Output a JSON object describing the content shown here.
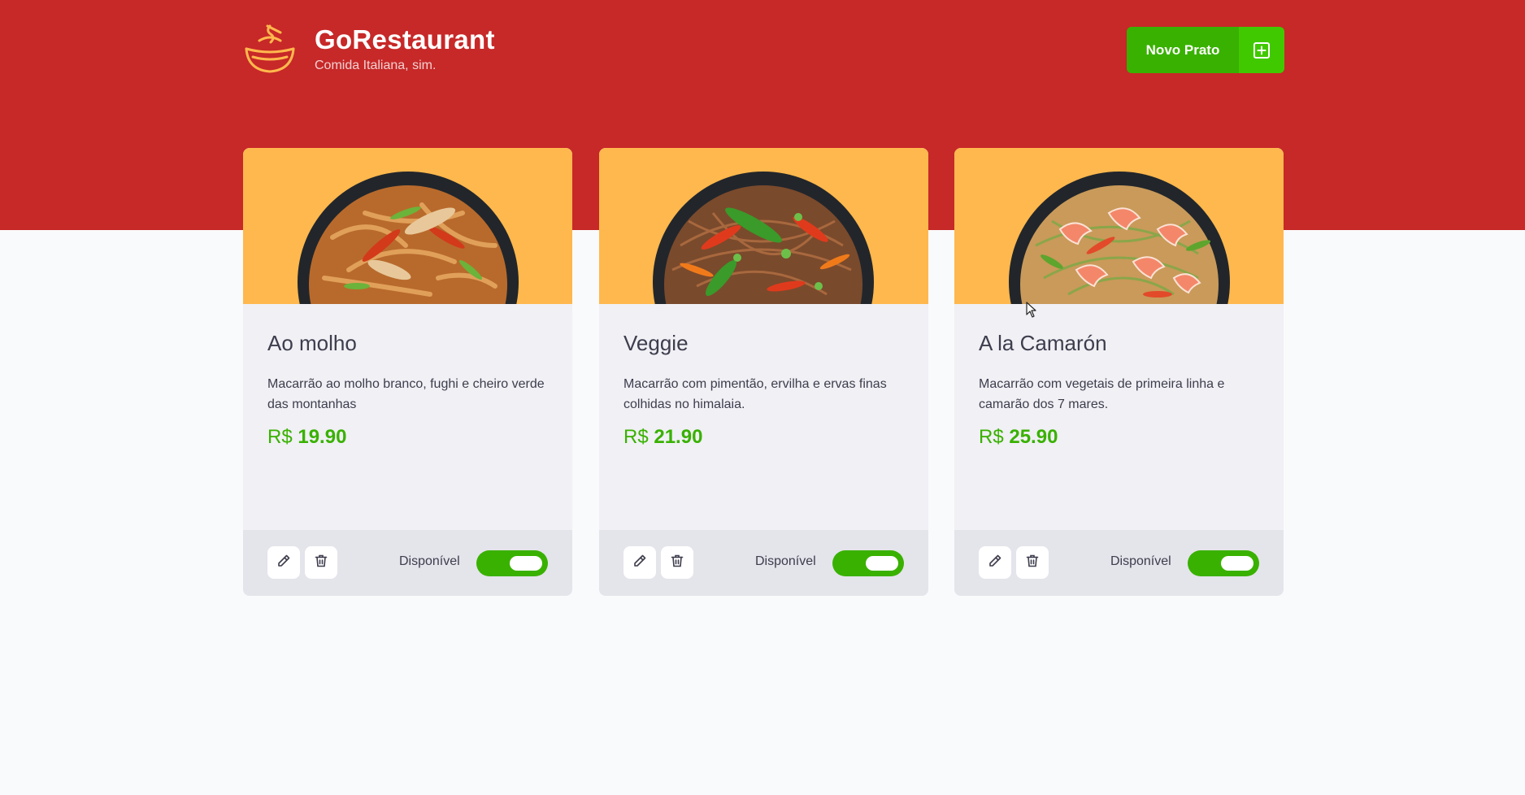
{
  "brand": {
    "name": "GoRestaurant",
    "subtitle": "Comida Italiana, sim."
  },
  "header": {
    "new_button_label": "Novo Prato",
    "new_button_icon": "plus-square-icon"
  },
  "colors": {
    "hero": "#c72828",
    "accent_green": "#39b100",
    "card_image_bg": "#ffb84d",
    "text_dark": "#3d3d4d"
  },
  "foods": [
    {
      "name": "Ao molho",
      "description": "Macarrão ao molho branco, fughi e cheiro verde das montanhas",
      "currency": "R$",
      "price": "19.90",
      "available_label": "Disponível",
      "available": true
    },
    {
      "name": "Veggie",
      "description": "Macarrão com pimentão, ervilha e ervas finas colhidas no himalaia.",
      "currency": "R$",
      "price": "21.90",
      "available_label": "Disponível",
      "available": true
    },
    {
      "name": "A la Camarón",
      "description": "Macarrão com vegetais de primeira linha e camarão dos 7 mares.",
      "currency": "R$",
      "price": "25.90",
      "available_label": "Disponível",
      "available": true
    }
  ]
}
